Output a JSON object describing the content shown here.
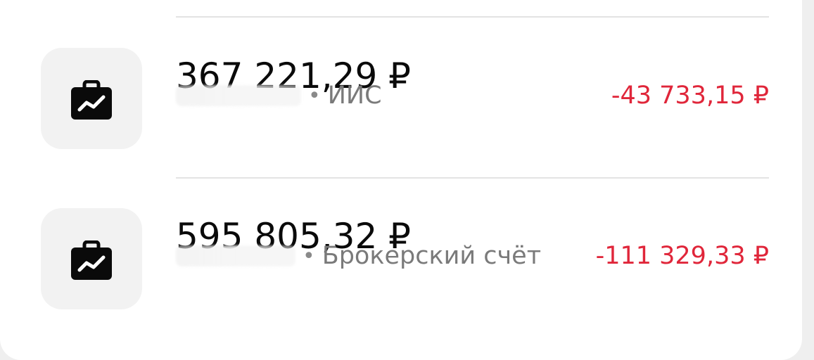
{
  "accounts": [
    {
      "amount": "367 221,29 ₽",
      "type": "ИИС",
      "change": "-43 733,15 ₽",
      "icon": "portfolio-icon"
    },
    {
      "amount": "595 805,32 ₽",
      "type": "Брокерский счёт",
      "change": "-111 329,33 ₽",
      "icon": "portfolio-icon"
    }
  ],
  "separator": "•",
  "colors": {
    "negative": "#e0263a",
    "secondary_text": "#7a7a7a",
    "icon_tile": "#f2f2f2"
  }
}
